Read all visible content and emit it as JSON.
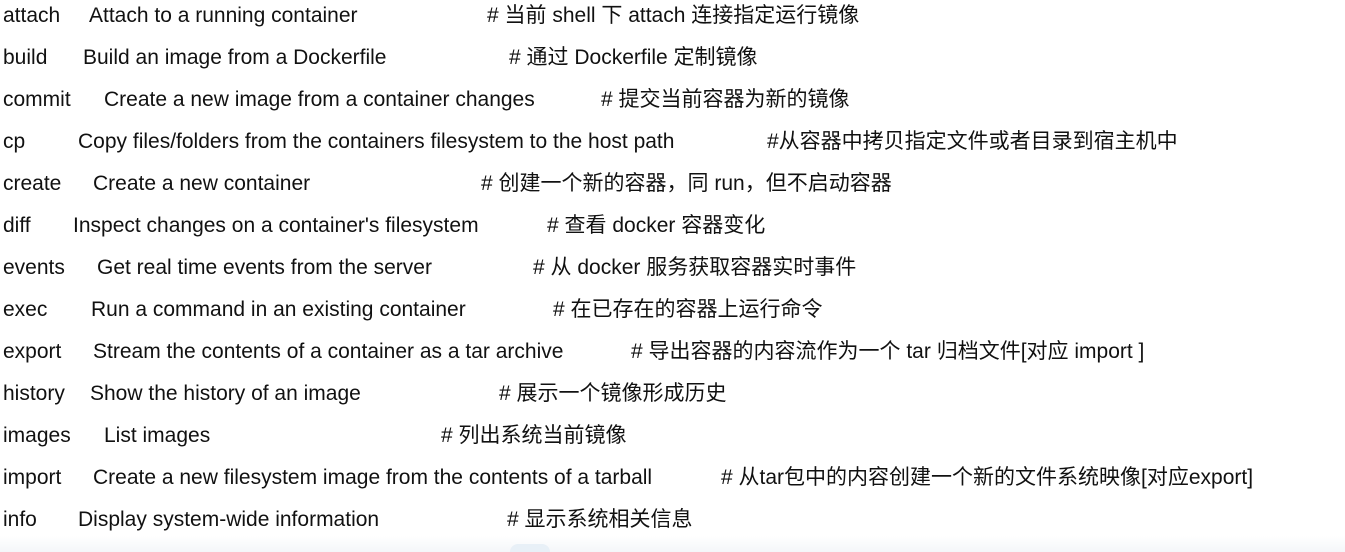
{
  "commands": [
    {
      "name": "attach",
      "desc": "Attach to a running container",
      "comment": "# 当前 shell 下 attach 连接指定运行镜像"
    },
    {
      "name": "build",
      "desc": "Build an image from a Dockerfile",
      "comment": "# 通过 Dockerfile 定制镜像"
    },
    {
      "name": "commit",
      "desc": "Create a new image from a container changes",
      "comment": "# 提交当前容器为新的镜像"
    },
    {
      "name": "cp",
      "desc": "Copy files/folders from the containers filesystem to the host path",
      "comment": "#从容器中拷贝指定文件或者目录到宿主机中"
    },
    {
      "name": "create",
      "desc": "Create a new container",
      "comment": "# 创建一个新的容器，同 run，但不启动容器"
    },
    {
      "name": "diff",
      "desc": "Inspect changes on a container's filesystem",
      "comment": "# 查看 docker 容器变化"
    },
    {
      "name": "events",
      "desc": "Get real time events from the server",
      "comment": "# 从 docker 服务获取容器实时事件"
    },
    {
      "name": "exec",
      "desc": "Run a command in an existing container",
      "comment": "# 在已存在的容器上运行命令"
    },
    {
      "name": "export",
      "desc": "Stream the contents of a container as a tar archive",
      "comment": "# 导出容器的内容流作为一个 tar 归档文件[对应 import ]"
    },
    {
      "name": "history",
      "desc": "Show the history of an image",
      "comment": "# 展示一个镜像形成历史"
    },
    {
      "name": "images",
      "desc": "List images",
      "comment": "# 列出系统当前镜像"
    },
    {
      "name": "import",
      "desc": "Create a new filesystem image from the contents of a tarball",
      "comment": "# 从tar包中的内容创建一个新的文件系统映像[对应export]"
    },
    {
      "name": "info",
      "desc": "Display system-wide information",
      "comment": "# 显示系统相关信息"
    }
  ]
}
